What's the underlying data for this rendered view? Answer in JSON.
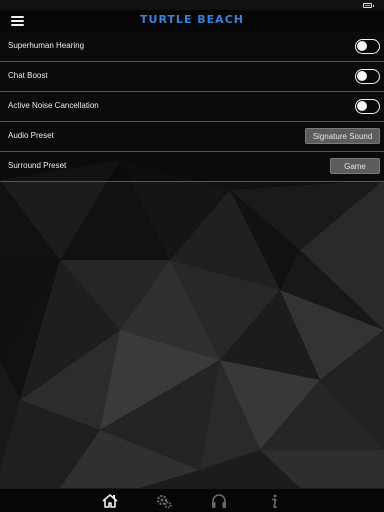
{
  "app": {
    "brand": "TURTLE BEACH"
  },
  "status_bar": {
    "battery_level": 0.7,
    "battery_color": "#3fe03f"
  },
  "settings": {
    "superhuman_hearing": {
      "label": "Superhuman Hearing",
      "enabled": false
    },
    "chat_boost": {
      "label": "Chat Boost",
      "enabled": false
    },
    "active_noise_cancellation": {
      "label": "Active Noise Cancellation",
      "enabled": false
    },
    "audio_preset": {
      "label": "Audio Preset",
      "value": "Signature Sound"
    },
    "surround_preset": {
      "label": "Surround Preset",
      "value": "Game"
    }
  },
  "tab_bar": {
    "tabs": [
      {
        "name": "home",
        "icon": "home-icon",
        "active": true
      },
      {
        "name": "settings",
        "icon": "gears-icon",
        "active": false
      },
      {
        "name": "headset",
        "icon": "headset-icon",
        "active": false
      },
      {
        "name": "info",
        "icon": "info-icon",
        "active": false
      }
    ]
  },
  "colors": {
    "accent": "#3a82d8",
    "divider": "#2d5f96",
    "button": "#5c5c5c"
  }
}
